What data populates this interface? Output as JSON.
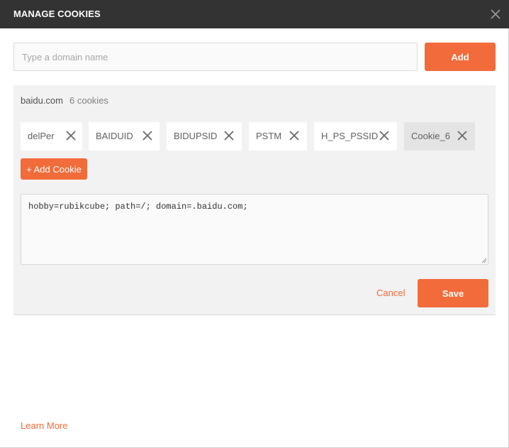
{
  "dialog": {
    "title": "MANAGE COOKIES",
    "close_icon": "close-icon"
  },
  "domain_form": {
    "placeholder": "Type a domain name",
    "value": "",
    "add_label": "Add"
  },
  "domain_panel": {
    "domain": "baidu.com",
    "count_text": "6 cookies",
    "cookies": [
      {
        "name": "delPer",
        "selected": false
      },
      {
        "name": "BAIDUID",
        "selected": false
      },
      {
        "name": "BIDUPSID",
        "selected": false
      },
      {
        "name": "PSTM",
        "selected": false
      },
      {
        "name": "H_PS_PSSID",
        "selected": false
      },
      {
        "name": "Cookie_6",
        "selected": true
      }
    ],
    "add_cookie_label": "+ Add Cookie",
    "cookie_value": "hobby=rubikcube; path=/; domain=.baidu.com;",
    "cancel_label": "Cancel",
    "save_label": "Save"
  },
  "footer": {
    "learn_more_label": "Learn More"
  },
  "colors": {
    "accent": "#f26b3a",
    "titlebar": "#333333",
    "panel": "#f2f2f2"
  }
}
